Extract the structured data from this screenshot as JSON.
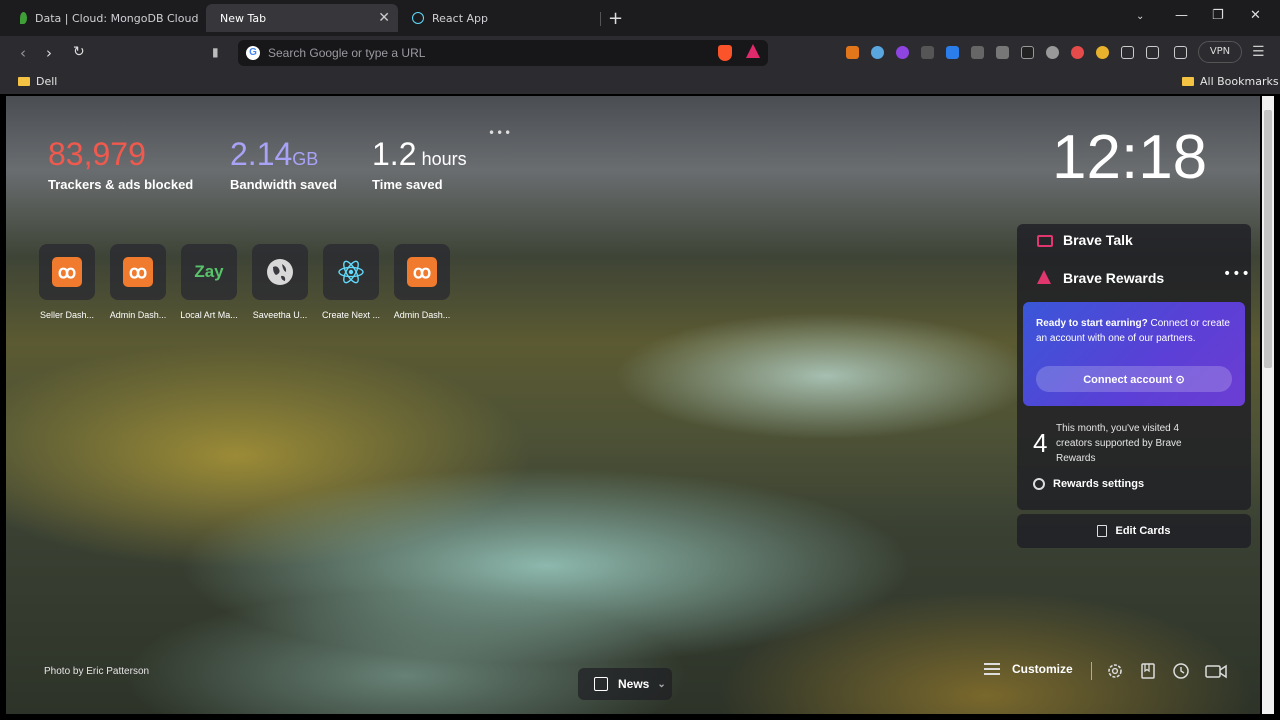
{
  "tabs": [
    {
      "label": "Data | Cloud: MongoDB Cloud",
      "active": false
    },
    {
      "label": "New Tab",
      "active": true
    },
    {
      "label": "React App",
      "active": false
    }
  ],
  "toolbar": {
    "search_placeholder": "Search Google or type a URL",
    "vpn_label": "VPN"
  },
  "bookmarks": {
    "left": "Dell",
    "right": "All Bookmarks"
  },
  "stats": {
    "trackers_value": "83,979",
    "trackers_label": "Trackers & ads blocked",
    "bandwidth_value": "2.14",
    "bandwidth_unit": "GB",
    "bandwidth_label": "Bandwidth saved",
    "time_value": "1.2",
    "time_unit": "hours",
    "time_label": "Time saved"
  },
  "clock": "12:18",
  "top_sites": [
    {
      "label": "Seller Dash...",
      "icon": "xampp-icon"
    },
    {
      "label": "Admin Dash...",
      "icon": "xampp-icon"
    },
    {
      "label": "Local Art Ma...",
      "icon": "zay-icon",
      "icon_text": "Zay"
    },
    {
      "label": "Saveetha U...",
      "icon": "globe-icon"
    },
    {
      "label": "Create Next ...",
      "icon": "react-icon"
    },
    {
      "label": "Admin Dash...",
      "icon": "xampp-icon"
    }
  ],
  "cards": {
    "talk_title": "Brave Talk",
    "rewards_title": "Brave Rewards",
    "earn_bold": "Ready to start earning?",
    "earn_text": " Connect or create an account with one of our partners.",
    "connect_label": "Connect account",
    "creators_count": "4",
    "creators_text": "This month, you've visited 4 creators supported by Brave Rewards",
    "settings_label": "Rewards settings",
    "edit_cards_label": "Edit Cards"
  },
  "footer": {
    "credit_prefix": "Photo by",
    "credit_author": "Eric Patterson",
    "news_label": "News",
    "customize_label": "Customize"
  },
  "colors": {
    "trackers": "#f05a4e",
    "bandwidth": "#a9a3f7",
    "brand_accent": "#e2366e"
  }
}
